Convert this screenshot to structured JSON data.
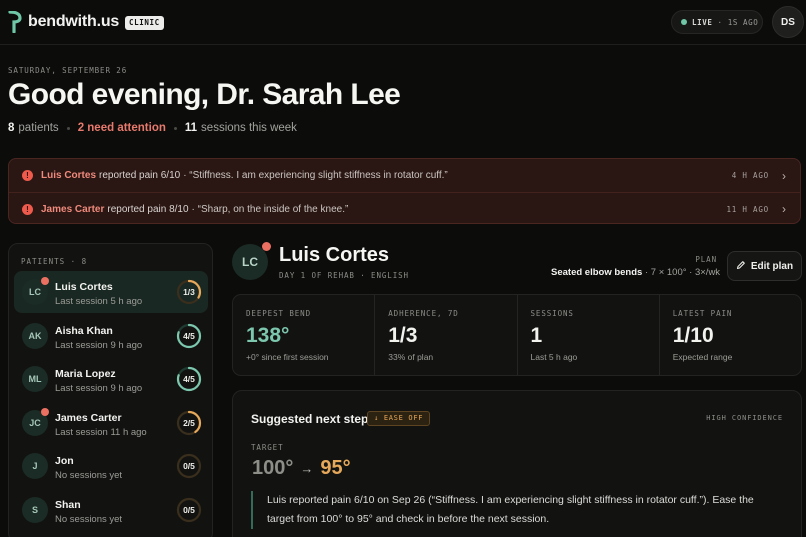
{
  "app": {
    "brand": "bendwith.us",
    "badge": "CLINIC",
    "live_label": "LIVE",
    "live_ago": "· 1S AGO",
    "user_initials": "DS",
    "colors": {
      "accent": "#6fc7a7",
      "alert": "#ec7062",
      "warning": "#e6a85a"
    }
  },
  "header": {
    "date": "SATURDAY, SEPTEMBER 26",
    "greeting": "Good evening, Dr. Sarah Lee",
    "patients_count": "8",
    "patients_word": "patients",
    "attention": "2 need attention",
    "sessions_count": "11",
    "sessions_word": "sessions this week"
  },
  "alerts": [
    {
      "name": "Luis Cortes",
      "text": "reported pain 6/10",
      "quote": "· “Stiffness. I am experiencing slight stiffness in rotator cuff.”",
      "time": "4 H AGO",
      "icon": "alert-circle-icon"
    },
    {
      "name": "James Carter",
      "text": "reported pain 8/10",
      "quote": "· “Sharp, on the inside of the knee.”",
      "time": "11 H AGO",
      "icon": "alert-circle-icon"
    }
  ],
  "patients": {
    "header": "PATIENTS · 8",
    "items": [
      {
        "initials": "LC",
        "name": "Luis Cortes",
        "sub": "Last session 5 h ago",
        "progress": "1/3",
        "fraction": 0.333,
        "alert": true,
        "selected": true,
        "ring_color": "#e6a85a"
      },
      {
        "initials": "AK",
        "name": "Aisha Khan",
        "sub": "Last session 9 h ago",
        "progress": "4/5",
        "fraction": 0.8,
        "alert": false,
        "selected": false,
        "ring_color": "#7cc7ae"
      },
      {
        "initials": "ML",
        "name": "Maria Lopez",
        "sub": "Last session 9 h ago",
        "progress": "4/5",
        "fraction": 0.8,
        "alert": false,
        "selected": false,
        "ring_color": "#7cc7ae"
      },
      {
        "initials": "JC",
        "name": "James Carter",
        "sub": "Last session 11 h ago",
        "progress": "2/5",
        "fraction": 0.4,
        "alert": true,
        "selected": false,
        "ring_color": "#e6a85a"
      },
      {
        "initials": "J",
        "name": "Jon",
        "sub": "No sessions yet",
        "progress": "0/5",
        "fraction": 0,
        "alert": false,
        "selected": false,
        "ring_color": "#e6a85a"
      },
      {
        "initials": "S",
        "name": "Shan",
        "sub": "No sessions yet",
        "progress": "0/5",
        "fraction": 0,
        "alert": false,
        "selected": false,
        "ring_color": "#e6a85a"
      }
    ]
  },
  "detail": {
    "initials": "LC",
    "name": "Luis Cortes",
    "meta": "DAY 1 OF REHAB · ENGLISH",
    "plan_label": "PLAN",
    "plan_exercise": "Seated elbow bends",
    "plan_spec": "· 7 × 100° · 3×/wk",
    "edit_label": "Edit plan",
    "metrics": [
      {
        "label": "DEEPEST BEND",
        "value": "138°",
        "sub": "+0° since first session"
      },
      {
        "label": "ADHERENCE, 7D",
        "value": "1/3",
        "sub": "33% of plan"
      },
      {
        "label": "SESSIONS",
        "value": "1",
        "sub": "Last 5 h ago"
      },
      {
        "label": "LATEST PAIN",
        "value": "1/10",
        "sub": "Expected range"
      }
    ]
  },
  "suggestion": {
    "title": "Suggested next step",
    "badge": "↓ EASE OFF",
    "confidence": "HIGH CONFIDENCE",
    "target_label": "TARGET",
    "from": "100°",
    "arrow": "→",
    "to": "95°",
    "body": "Luis reported pain 6/10 on Sep 26 (“Stiffness. I am experiencing slight stiffness in rotator cuff.”). Ease the target from 100° to 95° and check in before the next session."
  }
}
